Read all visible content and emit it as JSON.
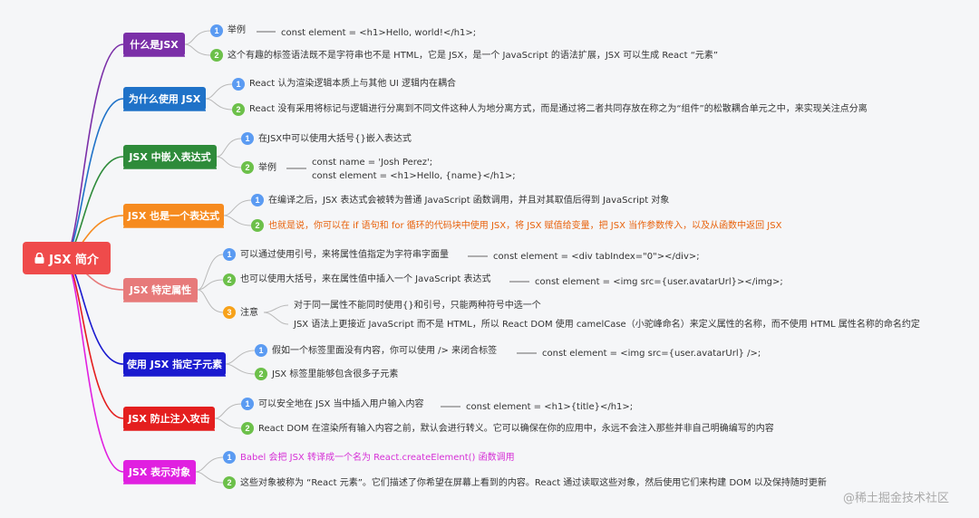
{
  "root": {
    "title": "JSX 简介",
    "icon": "lock-icon",
    "color": "#ef4b4b"
  },
  "topics": [
    {
      "id": "t1",
      "label": "什么是JSX",
      "color": "#7b2fa8",
      "items": [
        {
          "badge": "1",
          "badge_color": "blue",
          "text": "举例",
          "detail": "const element = <h1>Hello, world!</h1>;"
        },
        {
          "badge": "2",
          "badge_color": "green",
          "text": "这个有趣的标签语法既不是字符串也不是 HTML，它是 JSX，是一个 JavaScript 的语法扩展，JSX 可以生成 React “元素”"
        }
      ]
    },
    {
      "id": "t2",
      "label": "为什么使用 JSX",
      "color": "#1f72c8",
      "items": [
        {
          "badge": "1",
          "badge_color": "blue",
          "text": "React 认为渲染逻辑本质上与其他 UI 逻辑内在耦合"
        },
        {
          "badge": "2",
          "badge_color": "green",
          "text": "React 没有采用将标记与逻辑进行分离到不同文件这种人为地分离方式，而是通过将二者共同存放在称之为“组件”的松散耦合单元之中，来实现关注点分离"
        }
      ]
    },
    {
      "id": "t3",
      "label": "JSX 中嵌入表达式",
      "color": "#2e8b3a",
      "items": [
        {
          "badge": "1",
          "badge_color": "blue",
          "text": "在JSX中可以使用大括号{}嵌入表达式"
        },
        {
          "badge": "2",
          "badge_color": "green",
          "text": "举例",
          "detail_lines": [
            "const name = 'Josh Perez';",
            "const element = <h1>Hello, {name}</h1>;"
          ]
        }
      ]
    },
    {
      "id": "t4",
      "label": "JSX 也是一个表达式",
      "color": "#f68b1f",
      "items": [
        {
          "badge": "1",
          "badge_color": "blue",
          "text": "在编译之后，JSX 表达式会被转为普通 JavaScript 函数调用，并且对其取值后得到 JavaScript 对象"
        },
        {
          "badge": "2",
          "badge_color": "green",
          "text": "也就是说，你可以在 if 语句和 for 循环的代码块中使用 JSX，将 JSX 赋值给变量，把 JSX 当作参数传入，以及从函数中返回 JSX",
          "highlight": "#e8620c"
        }
      ]
    },
    {
      "id": "t5",
      "label": "JSX 特定属性",
      "color": "#e77a7a",
      "items": [
        {
          "badge": "1",
          "badge_color": "blue",
          "text": "可以通过使用引号，来将属性值指定为字符串字面量",
          "detail": "const element = <div tabIndex=\"0\"></div>;"
        },
        {
          "badge": "2",
          "badge_color": "green",
          "text": "也可以使用大括号，来在属性值中插入一个 JavaScript 表达式",
          "detail": "const element = <img src={user.avatarUrl}></img>;"
        },
        {
          "badge": "3",
          "badge_color": "orange",
          "text": "注意",
          "sub": [
            "对于同一属性不能同时使用{}和引号，只能两种符号中选一个",
            "JSX 语法上更接近 JavaScript 而不是 HTML，所以 React DOM 使用 camelCase（小驼峰命名）来定义属性的名称，而不使用 HTML 属性名称的命名约定"
          ]
        }
      ]
    },
    {
      "id": "t6",
      "label": "使用 JSX 指定子元素",
      "color": "#1a1acf",
      "items": [
        {
          "badge": "1",
          "badge_color": "blue",
          "text": "假如一个标签里面没有内容，你可以使用 /> 来闭合标签",
          "detail": "const element = <img src={user.avatarUrl} />;"
        },
        {
          "badge": "2",
          "badge_color": "green",
          "text": "JSX 标签里能够包含很多子元素"
        }
      ]
    },
    {
      "id": "t7",
      "label": "JSX 防止注入攻击",
      "color": "#e41e1e",
      "items": [
        {
          "badge": "1",
          "badge_color": "blue",
          "text": "可以安全地在 JSX 当中插入用户输入内容",
          "detail": "const element = <h1>{title}</h1>;"
        },
        {
          "badge": "2",
          "badge_color": "green",
          "text": "React DOM 在渲染所有输入内容之前，默认会进行转义。它可以确保在你的应用中，永远不会注入那些并非自己明确编写的内容"
        }
      ]
    },
    {
      "id": "t8",
      "label": "JSX 表示对象",
      "color": "#e020e0",
      "items": [
        {
          "badge": "1",
          "badge_color": "blue",
          "text": "Babel 会把 JSX 转译成一个名为 React.createElement() 函数调用",
          "highlight": "#d62fd6"
        },
        {
          "badge": "2",
          "badge_color": "green",
          "text": "这些对象被称为 “React 元素”。它们描述了你希望在屏幕上看到的内容。React 通过读取这些对象，然后使用它们来构建 DOM 以及保持随时更新"
        }
      ]
    }
  ],
  "watermark": "@稀土掘金技术社区"
}
